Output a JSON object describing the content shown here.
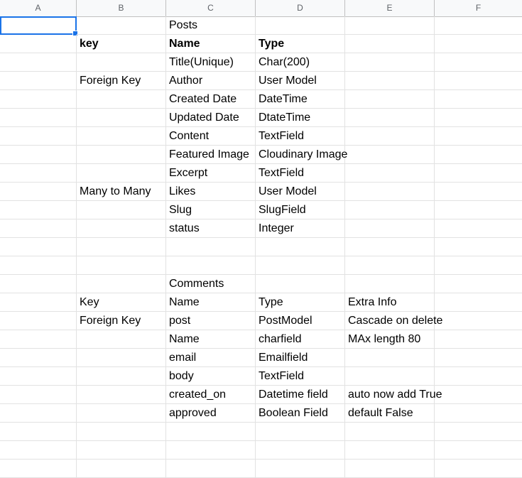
{
  "columns": [
    "A",
    "B",
    "C",
    "D",
    "E",
    "F"
  ],
  "rows": [
    [
      "",
      "",
      "Posts",
      "",
      "",
      ""
    ],
    [
      "",
      "key",
      "Name",
      "Type",
      "",
      ""
    ],
    [
      "",
      "",
      "Title(Unique)",
      "Char(200)",
      "",
      ""
    ],
    [
      "",
      "Foreign Key",
      "Author",
      "User Model",
      "",
      ""
    ],
    [
      "",
      "",
      "Created Date",
      "DateTime",
      "",
      ""
    ],
    [
      "",
      "",
      "Updated Date",
      "DtateTime",
      "",
      ""
    ],
    [
      "",
      "",
      "Content",
      "TextField",
      "",
      ""
    ],
    [
      "",
      "",
      "Featured Image",
      "Cloudinary Image",
      "",
      ""
    ],
    [
      "",
      "",
      "Excerpt",
      "TextField",
      "",
      ""
    ],
    [
      "",
      "Many to Many",
      "Likes",
      "User Model",
      "",
      ""
    ],
    [
      "",
      "",
      "Slug",
      "SlugField",
      "",
      ""
    ],
    [
      "",
      "",
      "status",
      "Integer",
      "",
      ""
    ],
    [
      "",
      "",
      "",
      "",
      "",
      ""
    ],
    [
      "",
      "",
      "",
      "",
      "",
      ""
    ],
    [
      "",
      "",
      "Comments",
      "",
      "",
      ""
    ],
    [
      "",
      "Key",
      "Name",
      "Type",
      "Extra Info",
      ""
    ],
    [
      "",
      "Foreign Key",
      "post",
      "PostModel",
      "Cascade on delete",
      ""
    ],
    [
      "",
      "",
      "Name",
      "charfield",
      "MAx length 80",
      ""
    ],
    [
      "",
      "",
      "email",
      "Emailfield",
      "",
      ""
    ],
    [
      "",
      "",
      "body",
      "TextField",
      "",
      ""
    ],
    [
      "",
      "",
      "created_on",
      "Datetime field",
      "auto now add True",
      ""
    ],
    [
      "",
      "",
      "approved",
      "Boolean Field",
      "default False",
      ""
    ],
    [
      "",
      "",
      "",
      "",
      "",
      ""
    ],
    [
      "",
      "",
      "",
      "",
      "",
      ""
    ],
    [
      "",
      "",
      "",
      "",
      "",
      ""
    ]
  ],
  "colors": {
    "selection": "#1a73e8",
    "header_bg": "#f8f9fa",
    "grid_line": "#e2e2e2"
  }
}
